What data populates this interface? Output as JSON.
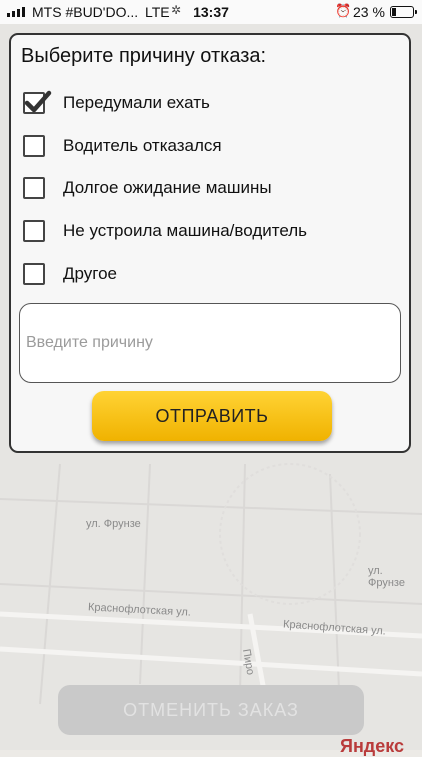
{
  "status_bar": {
    "carrier": "MTS #BUD'DO...",
    "network": "LTE",
    "time": "13:37",
    "battery": "23 %"
  },
  "dialog": {
    "title": "Выберите причину отказа:",
    "options": [
      {
        "label": "Передумали ехать",
        "checked": true
      },
      {
        "label": "Водитель отказался",
        "checked": false
      },
      {
        "label": "Долгое ожидание машины",
        "checked": false
      },
      {
        "label": "Не устроила машина/водитель",
        "checked": false
      },
      {
        "label": "Другое",
        "checked": false
      }
    ],
    "reason_placeholder": "Введите причину",
    "reason_value": "",
    "submit_label": "ОТПРАВИТЬ"
  },
  "map": {
    "streets": [
      "ул. Фрунзе",
      "Краснофлотская ул.",
      "Краснофлотская ул.",
      "ул. Фрунзе",
      "Пиро"
    ],
    "cancel_label": "ОТМЕНИТЬ ЗАКАЗ",
    "brand": "Яндекс"
  },
  "colors": {
    "accent": "#f7c21a",
    "modal_bg": "#f7f7f7",
    "overlay": "#ebe9e5"
  },
  "icons": [
    "signal-icon",
    "loading-icon",
    "alarm-icon",
    "battery-icon",
    "check-icon"
  ]
}
